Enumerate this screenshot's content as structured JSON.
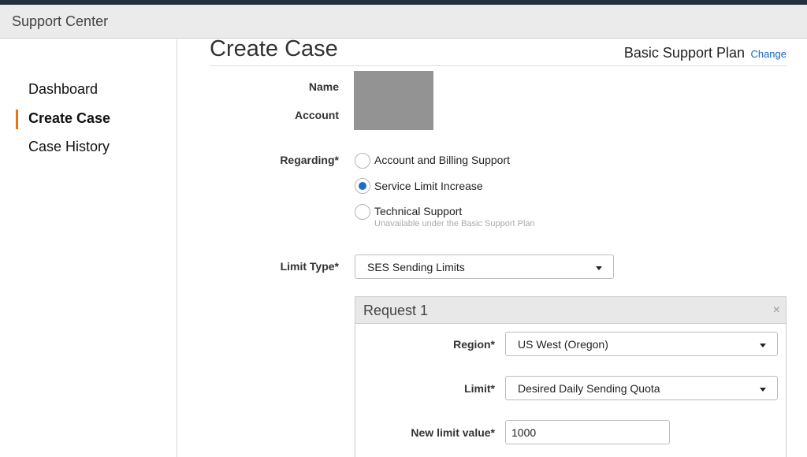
{
  "app": {
    "title": "Support Center"
  },
  "sidebar": {
    "items": [
      {
        "label": "Dashboard",
        "active": false
      },
      {
        "label": "Create Case",
        "active": true
      },
      {
        "label": "Case History",
        "active": false
      }
    ]
  },
  "header": {
    "title": "Create Case",
    "plan": "Basic Support Plan",
    "change_label": "Change"
  },
  "form": {
    "name_label": "Name",
    "account_label": "Account",
    "regarding": {
      "label": "Regarding*",
      "options": [
        {
          "label": "Account and Billing Support",
          "checked": false
        },
        {
          "label": "Service Limit Increase",
          "checked": true
        },
        {
          "label": "Technical Support",
          "checked": false,
          "note": "Unavailable under the Basic Support Plan"
        }
      ]
    },
    "limit_type": {
      "label": "Limit Type*",
      "value": "SES Sending Limits"
    },
    "request": {
      "title": "Request 1",
      "close_icon": "×",
      "region": {
        "label": "Region*",
        "value": "US West (Oregon)"
      },
      "limit": {
        "label": "Limit*",
        "value": "Desired Daily Sending Quota"
      },
      "new_limit": {
        "label": "New limit value*",
        "value": "1000"
      }
    }
  },
  "colors": {
    "accent": "#ec7211",
    "link": "#1166bb",
    "radio_selected": "#1a6fc4"
  }
}
